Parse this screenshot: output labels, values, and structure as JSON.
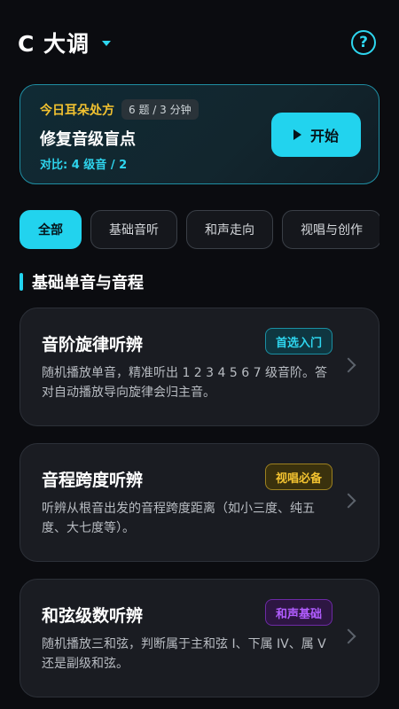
{
  "header": {
    "key_title": "C 大调",
    "help_icon": "help-circle-icon"
  },
  "today": {
    "label": "今日耳朵处方",
    "meta": "6 题 / 3 分钟",
    "title": "修复音级盲点",
    "compare": "对比: 4 级音 / 2",
    "start_label": "开始"
  },
  "tabs": [
    {
      "label": "全部",
      "active": true
    },
    {
      "label": "基础音听",
      "active": false
    },
    {
      "label": "和声走向",
      "active": false
    },
    {
      "label": "视唱与创作",
      "active": false
    }
  ],
  "section": {
    "title": "基础单音与音程"
  },
  "lessons": [
    {
      "name": "音阶旋律听辨",
      "badge": "首选入门",
      "desc": "随机播放单音，精准听出 1 2 3 4 5 6 7 级音阶。答对自动播放导向旋律会归主音。"
    },
    {
      "name": "音程跨度听辨",
      "badge": "视唱必备",
      "desc": "听辨从根音出发的音程跨度距离（如小三度、纯五度、大七度等）。"
    },
    {
      "name": "和弦级数听辨",
      "badge": "和声基础",
      "desc": "随机播放三和弦，判断属于主和弦 I、下属 IV、属 V 还是副级和弦。"
    }
  ],
  "colors": {
    "accent": "#22d3ee",
    "gold": "#f2c230",
    "purple": "#b15cff",
    "background": "#0b0c10"
  }
}
